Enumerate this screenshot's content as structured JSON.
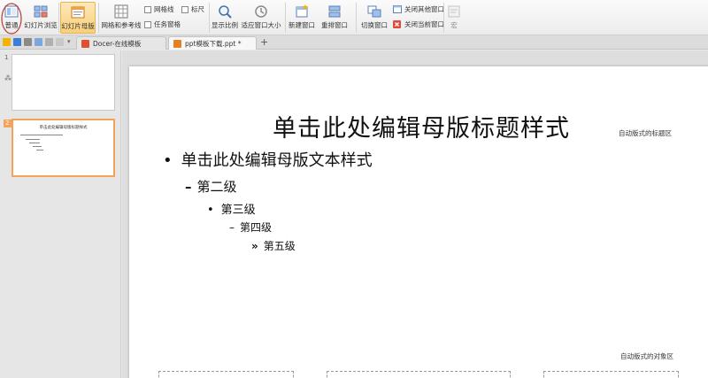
{
  "ribbon": {
    "normal_label": "普通",
    "sorter_label": "幻灯片浏览",
    "master_label": "幻灯片母版",
    "grid_ref_label": "网格和参考线",
    "gridlines_label": "网格线",
    "ruler_label": "标尺",
    "taskpane_label": "任务窗格",
    "zoom_label": "显示比例",
    "fit_label": "适应窗口大小",
    "new_window_label": "新建窗口",
    "arrange_label": "重排窗口",
    "switch_window_label": "切换窗口",
    "close_other_label": "关闭其他窗口",
    "close_current_label": "关闭当前窗口",
    "macro_label": "宏"
  },
  "tabs": [
    {
      "label": "Docer-在线模板"
    },
    {
      "label": "ppt模板下载.ppt *"
    }
  ],
  "thumbnails": [
    {
      "number": "1"
    },
    {
      "number": "2",
      "title": "单击此处编辑母版标题样式"
    }
  ],
  "slide": {
    "title": "单击此处编辑母版标题样式",
    "title_area_label": "自动版式的标题区",
    "object_area_label": "自动版式的对象区",
    "levels": [
      {
        "marker": "•",
        "text": "单击此处编辑母版文本样式"
      },
      {
        "marker": "–",
        "text": "第二级"
      },
      {
        "marker": "•",
        "text": "第三级"
      },
      {
        "marker": "–",
        "text": "第四级"
      },
      {
        "marker": "»",
        "text": "第五级"
      }
    ]
  },
  "colors": {
    "accent_orange": "#f5a25a",
    "active_button": "#f8cf79",
    "close_red": "#e04a3a",
    "icon_blue": "#3b7dd8"
  }
}
